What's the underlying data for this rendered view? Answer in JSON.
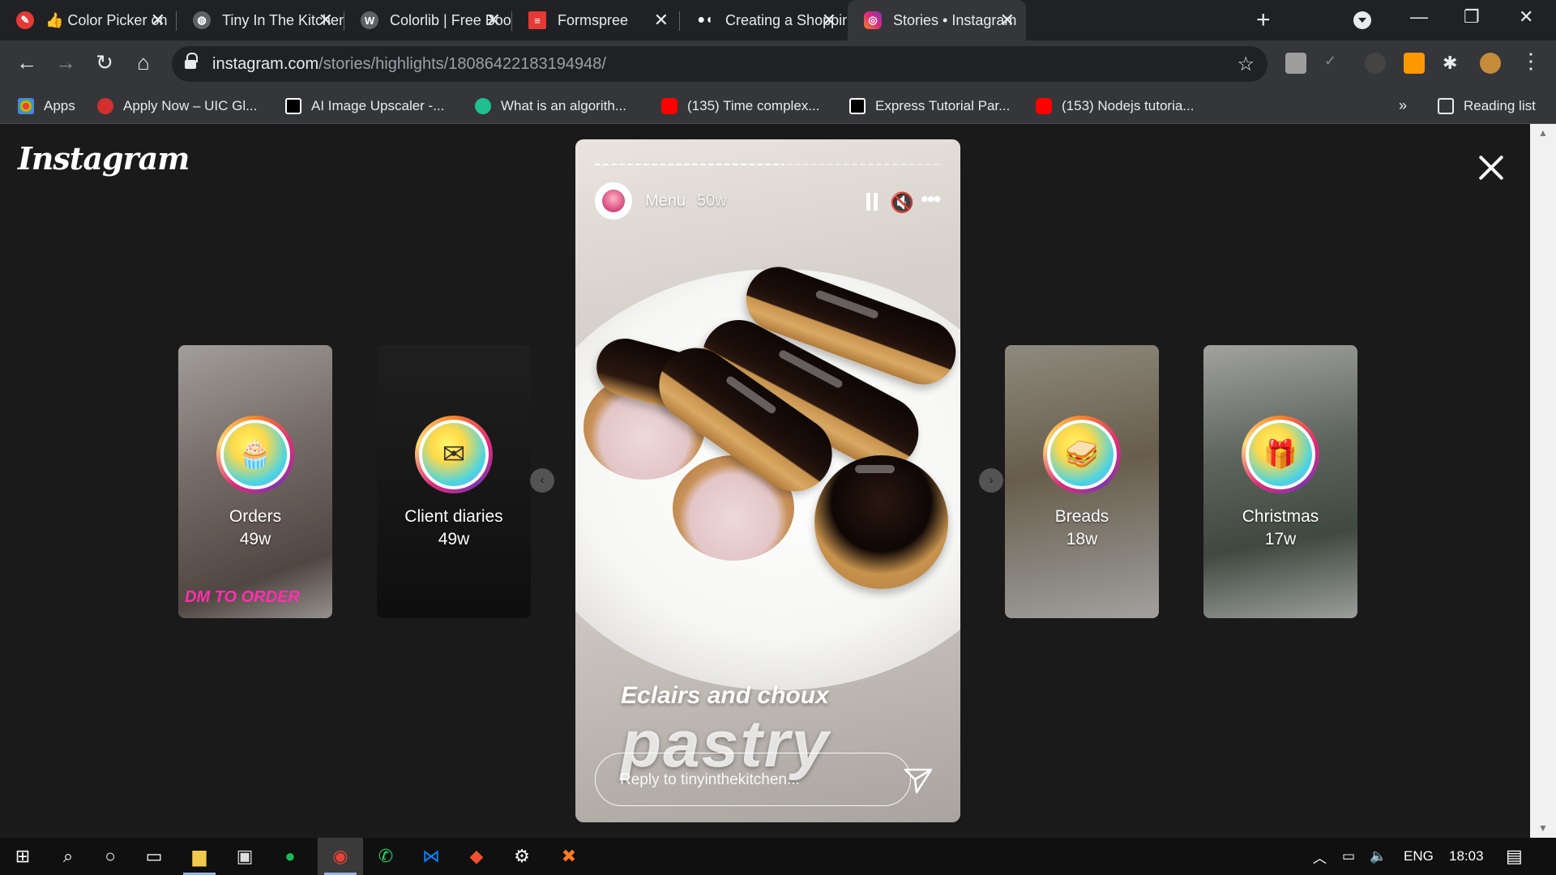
{
  "browser": {
    "tabs": [
      {
        "title": "👍 Color Picker onli",
        "favicon_color": "#e53935",
        "active": false
      },
      {
        "title": "Tiny In The Kitchen",
        "favicon_color": "#5f6368",
        "active": false
      },
      {
        "title": "Colorlib | Free Boots",
        "favicon_color": "#5f6368",
        "active": false
      },
      {
        "title": "Formspree",
        "favicon_color": "#e53935",
        "active": false
      },
      {
        "title": "Creating a Shoppin",
        "favicon_color": "#ffffff",
        "active": false
      },
      {
        "title": "Stories • Instagram",
        "favicon_color": "#d6249f",
        "active": true
      }
    ],
    "new_tab_icon": "+",
    "window_controls": [
      "—",
      "❐",
      "✕"
    ],
    "url_host": "instagram.com",
    "url_path": "/stories/highlights/18086422183194948/",
    "bookmarks": [
      {
        "label": "Apps",
        "color": "#ea4335"
      },
      {
        "label": "Apply Now – UIC Gl...",
        "color": "#d32f2f"
      },
      {
        "label": "AI Image Upscaler -...",
        "color": "#000000"
      },
      {
        "label": "What is an algorith...",
        "color": "#1fbf8f"
      },
      {
        "label": "(135) Time complex...",
        "color": "#ff0000"
      },
      {
        "label": "Express Tutorial Par...",
        "color": "#000000"
      },
      {
        "label": "(153) Nodejs tutoria...",
        "color": "#ff0000"
      }
    ],
    "bookmarks_overflow": "»",
    "reading_list": "Reading list"
  },
  "instagram": {
    "logo": "Instagram",
    "highlights_left": [
      {
        "name": "Orders",
        "age": "49w",
        "icon": "🧁",
        "bg": "#a79a94",
        "badge": "DM TO ORDER"
      },
      {
        "name": "Client diaries",
        "age": "49w",
        "icon": "✉",
        "bg": "#1f1f1f"
      }
    ],
    "highlights_right": [
      {
        "name": "Breads",
        "age": "18w",
        "icon": "🥪",
        "bg": "#8d8a7d"
      },
      {
        "name": "Christmas",
        "age": "17w",
        "icon": "🎁",
        "bg": "#6f7a70"
      }
    ],
    "story": {
      "username": "Menu",
      "age": "50w",
      "progress_fraction": 0.55,
      "caption_line1": "Eclairs and choux",
      "caption_line2": "pastry",
      "reply_placeholder": "Reply to tinyinthekitchen..."
    }
  },
  "taskbar": {
    "apps": [
      "windows-start",
      "search",
      "cortana",
      "task-view",
      "file-explorer",
      "store",
      "spotify",
      "chrome",
      "whatsapp",
      "vscode",
      "git",
      "settings",
      "xampp"
    ],
    "language": "ENG",
    "time": "18:03"
  }
}
